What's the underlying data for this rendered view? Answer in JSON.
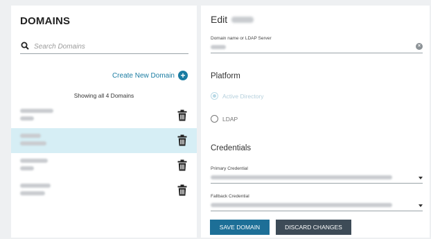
{
  "left": {
    "title": "DOMAINS",
    "search_placeholder": "Search Domains",
    "create_label": "Create New Domain",
    "showing_text": "Showing all 4 Domains",
    "domains": [
      {
        "selected": false
      },
      {
        "selected": true
      },
      {
        "selected": false
      },
      {
        "selected": false
      }
    ]
  },
  "right": {
    "edit_label": "Edit",
    "domain_field_label": "Domain name or LDAP Server",
    "platform_heading": "Platform",
    "platform_options": [
      "Active Directory",
      "LDAP"
    ],
    "platform_selected": "Active Directory",
    "credentials_heading": "Credentials",
    "primary_label": "Primary Credential",
    "fallback_label": "Fallback Credential",
    "save_label": "SAVE DOMAIN",
    "discard_label": "DISCARD CHANGES"
  },
  "colors": {
    "accent": "#1a7ca2",
    "selected_row": "#d6eef5",
    "save_button": "#1d6f97",
    "discard_button": "#3d4b57"
  },
  "icons": [
    "search-icon",
    "plus-circle-icon",
    "trash-icon",
    "clear-icon",
    "dropdown-caret-icon"
  ]
}
